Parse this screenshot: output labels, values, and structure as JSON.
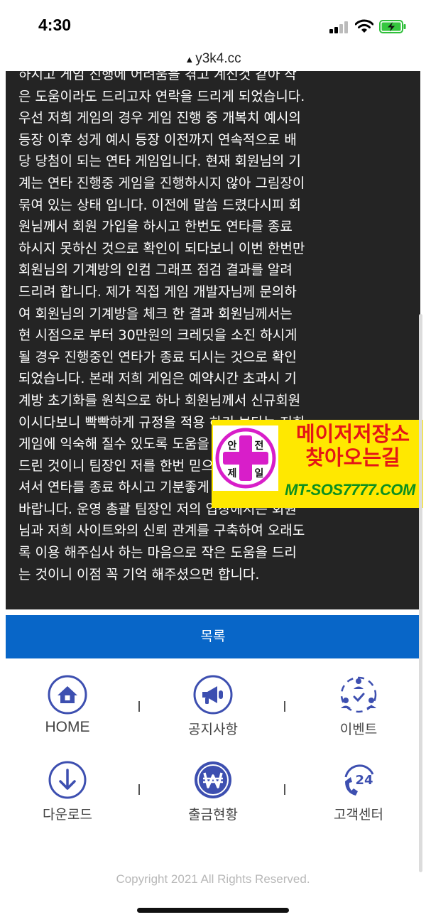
{
  "status_bar": {
    "time": "4:30"
  },
  "browser": {
    "url": "y3k4.cc",
    "warning_icon": "warning-triangle-icon"
  },
  "article": {
    "text": "하시고 게임 진행에 어려움을 겪고 계신것 같아 작\n은 도움이라도 드리고자 연락을 드리게 되었습니다.\n우선 저희 게임의 경우 게임 진행 중 개복치 예시의\n등장 이후 성게 예시 등장 이전까지 연속적으로 배\n당 당첨이 되는 연타 게임입니다. 현재 회원님의 기\n계는 연타 진행중 게임을 진행하시지 않아 그림장이\n묶여 있는 상태 입니다. 이전에 말씀 드렸다시피 회\n원님께서 회원 가입을 하시고 한번도 연타를 종료\n하시지 못하신 것으로 확인이 되다보니 이번 한번만\n회원님의 기계방의 인컴 그래프 점검 결과를 알려\n드리려 합니다. 제가 직접 게임 개발자님께 문의하\n여 회원님의 기계방을 체크 한 결과 회원님께서는\n현 시점으로 부터 30만원의 크레딧을 소진 하시게\n될 경우 진행중인 연타가 종료 되시는 것으로 확인\n되었습니다. 본래 저희 게임은 예약시간 초과시 기\n계방 초기화를 원칙으로 하나 회원님께서 신규회원\n이시다보니 빡빡하게 규정을 적용 하기 보다는 저희\n게임에 익숙해 질수 있도록 도움을 드리고자 말씀\n드린 것이니 팀장인 저를 한번 믿으시고 진행 해주\n셔서 연타를 종료 하시고 기분좋게 출금 하시기를\n바랍니다. 운영 총괄 팀장인 저의 입장에서는 회원\n님과 저희 사이트와의 신뢰 관계를 구축하여 오래도\n록 이용 해주십사 하는 마음으로 작은 도움을 드리\n는 것이니 이점 꼭 기억 해주셨으면 합니다."
  },
  "ad": {
    "badge_chars": [
      "안",
      "전",
      "제",
      "일"
    ],
    "title_line1": "메이저저장소",
    "title_line2": "찾아오는길",
    "url": "MT-SOS7777.COM",
    "colors": {
      "background": "#ffe800",
      "title": "#e41616",
      "url": "#0c8f1f",
      "badge": "#d81ec9"
    }
  },
  "list_button": {
    "label": "목록"
  },
  "bottom_menu": [
    {
      "label": "HOME",
      "icon": "home-icon"
    },
    {
      "label": "공지사항",
      "icon": "megaphone-icon"
    },
    {
      "label": "이벤트",
      "icon": "event-people-icon"
    },
    {
      "label": "다운로드",
      "icon": "download-icon"
    },
    {
      "label": "출금현황",
      "icon": "won-coin-icon"
    },
    {
      "label": "고객센터",
      "icon": "support-24-icon"
    }
  ],
  "footer": {
    "copyright": "Copyright 2021 All Rights Reserved."
  },
  "theme": {
    "primary": "#0866c8",
    "icon_blue": "#3d4fb0",
    "article_bg": "#242424"
  }
}
